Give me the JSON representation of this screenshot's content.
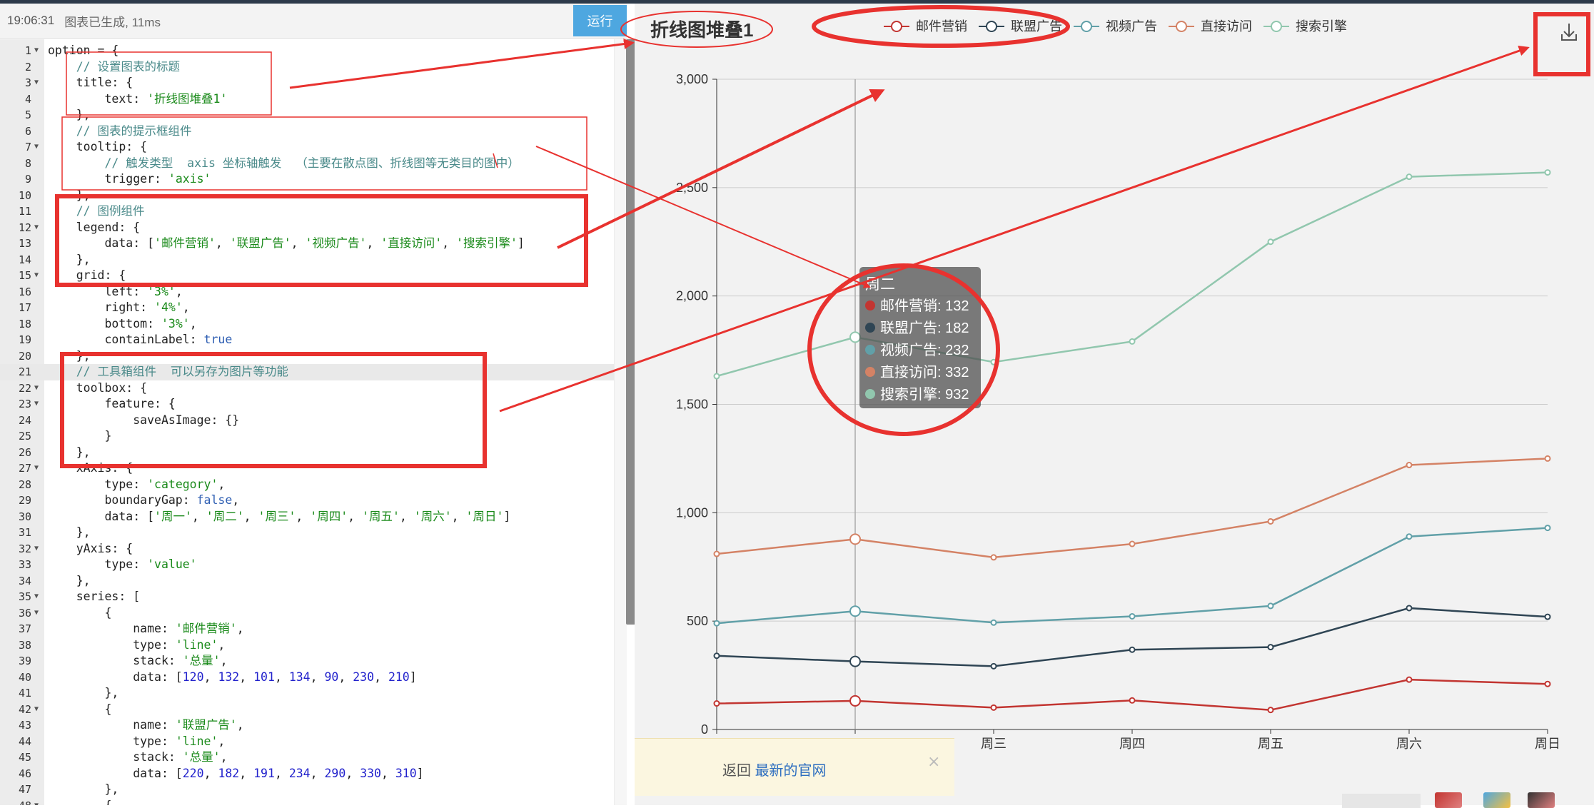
{
  "editor": {
    "status_time": "19:06:31",
    "status_text": "图表已生成, 11ms",
    "run_label": "运行",
    "lines": [
      {
        "n": "1",
        "fold": true,
        "t": [
          [
            "k",
            "option = {"
          ]
        ]
      },
      {
        "n": "2",
        "t": [
          [
            "k",
            "    "
          ],
          [
            "c",
            "// 设置图表的标题"
          ]
        ]
      },
      {
        "n": "3",
        "fold": true,
        "t": [
          [
            "k",
            "    title: {"
          ]
        ]
      },
      {
        "n": "4",
        "t": [
          [
            "k",
            "        text: "
          ],
          [
            "s",
            "'折线图堆叠1'"
          ]
        ]
      },
      {
        "n": "5",
        "t": [
          [
            "k",
            "    },"
          ]
        ]
      },
      {
        "n": "6",
        "t": [
          [
            "k",
            "    "
          ],
          [
            "c",
            "// 图表的提示框组件"
          ]
        ]
      },
      {
        "n": "7",
        "fold": true,
        "t": [
          [
            "k",
            "    tooltip: {"
          ]
        ]
      },
      {
        "n": "8",
        "t": [
          [
            "k",
            "        "
          ],
          [
            "c",
            "// 触发类型  axis 坐标轴触发  （主要在散点图、折线图等无类目的图中）"
          ]
        ]
      },
      {
        "n": "9",
        "t": [
          [
            "k",
            "        trigger: "
          ],
          [
            "s",
            "'axis'"
          ]
        ]
      },
      {
        "n": "10",
        "t": [
          [
            "k",
            "    },"
          ]
        ]
      },
      {
        "n": "11",
        "t": [
          [
            "k",
            "    "
          ],
          [
            "c",
            "// 图例组件"
          ]
        ]
      },
      {
        "n": "12",
        "fold": true,
        "t": [
          [
            "k",
            "    legend: {"
          ]
        ]
      },
      {
        "n": "13",
        "t": [
          [
            "k",
            "        data: ["
          ],
          [
            "s",
            "'邮件营销'"
          ],
          [
            "k",
            ", "
          ],
          [
            "s",
            "'联盟广告'"
          ],
          [
            "k",
            ", "
          ],
          [
            "s",
            "'视频广告'"
          ],
          [
            "k",
            ", "
          ],
          [
            "s",
            "'直接访问'"
          ],
          [
            "k",
            ", "
          ],
          [
            "s",
            "'搜索引擎'"
          ],
          [
            "k",
            "]"
          ]
        ]
      },
      {
        "n": "14",
        "t": [
          [
            "k",
            "    },"
          ]
        ]
      },
      {
        "n": "15",
        "fold": true,
        "t": [
          [
            "k",
            "    grid: {"
          ]
        ]
      },
      {
        "n": "16",
        "t": [
          [
            "k",
            "        left: "
          ],
          [
            "s",
            "'3%'"
          ],
          [
            "k",
            ","
          ]
        ]
      },
      {
        "n": "17",
        "t": [
          [
            "k",
            "        right: "
          ],
          [
            "s",
            "'4%'"
          ],
          [
            "k",
            ","
          ]
        ]
      },
      {
        "n": "18",
        "t": [
          [
            "k",
            "        bottom: "
          ],
          [
            "s",
            "'3%'"
          ],
          [
            "k",
            ","
          ]
        ]
      },
      {
        "n": "19",
        "t": [
          [
            "k",
            "        containLabel: "
          ],
          [
            "b",
            "true"
          ]
        ]
      },
      {
        "n": "20",
        "t": [
          [
            "k",
            "    },"
          ]
        ]
      },
      {
        "n": "21",
        "active": true,
        "t": [
          [
            "k",
            "    "
          ],
          [
            "c",
            "// 工具箱组件  可以另存为图片等功能"
          ]
        ]
      },
      {
        "n": "22",
        "fold": true,
        "t": [
          [
            "k",
            "    toolbox: {"
          ]
        ]
      },
      {
        "n": "23",
        "fold": true,
        "t": [
          [
            "k",
            "        feature: {"
          ]
        ]
      },
      {
        "n": "24",
        "t": [
          [
            "k",
            "            saveAsImage: {}"
          ]
        ]
      },
      {
        "n": "25",
        "t": [
          [
            "k",
            "        }"
          ]
        ]
      },
      {
        "n": "26",
        "t": [
          [
            "k",
            "    },"
          ]
        ]
      },
      {
        "n": "27",
        "fold": true,
        "t": [
          [
            "k",
            "    xAxis: {"
          ]
        ]
      },
      {
        "n": "28",
        "t": [
          [
            "k",
            "        type: "
          ],
          [
            "s",
            "'category'"
          ],
          [
            "k",
            ","
          ]
        ]
      },
      {
        "n": "29",
        "t": [
          [
            "k",
            "        boundaryGap: "
          ],
          [
            "b",
            "false"
          ],
          [
            "k",
            ","
          ]
        ]
      },
      {
        "n": "30",
        "t": [
          [
            "k",
            "        data: ["
          ],
          [
            "s",
            "'周一'"
          ],
          [
            "k",
            ", "
          ],
          [
            "s",
            "'周二'"
          ],
          [
            "k",
            ", "
          ],
          [
            "s",
            "'周三'"
          ],
          [
            "k",
            ", "
          ],
          [
            "s",
            "'周四'"
          ],
          [
            "k",
            ", "
          ],
          [
            "s",
            "'周五'"
          ],
          [
            "k",
            ", "
          ],
          [
            "s",
            "'周六'"
          ],
          [
            "k",
            ", "
          ],
          [
            "s",
            "'周日'"
          ],
          [
            "k",
            "]"
          ]
        ]
      },
      {
        "n": "31",
        "t": [
          [
            "k",
            "    },"
          ]
        ]
      },
      {
        "n": "32",
        "fold": true,
        "t": [
          [
            "k",
            "    yAxis: {"
          ]
        ]
      },
      {
        "n": "33",
        "t": [
          [
            "k",
            "        type: "
          ],
          [
            "s",
            "'value'"
          ]
        ]
      },
      {
        "n": "34",
        "t": [
          [
            "k",
            "    },"
          ]
        ]
      },
      {
        "n": "35",
        "fold": true,
        "t": [
          [
            "k",
            "    series: ["
          ]
        ]
      },
      {
        "n": "36",
        "fold": true,
        "t": [
          [
            "k",
            "        {"
          ]
        ]
      },
      {
        "n": "37",
        "t": [
          [
            "k",
            "            name: "
          ],
          [
            "s",
            "'邮件营销'"
          ],
          [
            "k",
            ","
          ]
        ]
      },
      {
        "n": "38",
        "t": [
          [
            "k",
            "            type: "
          ],
          [
            "s",
            "'line'"
          ],
          [
            "k",
            ","
          ]
        ]
      },
      {
        "n": "39",
        "t": [
          [
            "k",
            "            stack: "
          ],
          [
            "s",
            "'总量'"
          ],
          [
            "k",
            ","
          ]
        ]
      },
      {
        "n": "40",
        "t": [
          [
            "k",
            "            data: ["
          ],
          [
            "n",
            "120"
          ],
          [
            "k",
            ", "
          ],
          [
            "n",
            "132"
          ],
          [
            "k",
            ", "
          ],
          [
            "n",
            "101"
          ],
          [
            "k",
            ", "
          ],
          [
            "n",
            "134"
          ],
          [
            "k",
            ", "
          ],
          [
            "n",
            "90"
          ],
          [
            "k",
            ", "
          ],
          [
            "n",
            "230"
          ],
          [
            "k",
            ", "
          ],
          [
            "n",
            "210"
          ],
          [
            "k",
            "]"
          ]
        ]
      },
      {
        "n": "41",
        "t": [
          [
            "k",
            "        },"
          ]
        ]
      },
      {
        "n": "42",
        "fold": true,
        "t": [
          [
            "k",
            "        {"
          ]
        ]
      },
      {
        "n": "43",
        "t": [
          [
            "k",
            "            name: "
          ],
          [
            "s",
            "'联盟广告'"
          ],
          [
            "k",
            ","
          ]
        ]
      },
      {
        "n": "44",
        "t": [
          [
            "k",
            "            type: "
          ],
          [
            "s",
            "'line'"
          ],
          [
            "k",
            ","
          ]
        ]
      },
      {
        "n": "45",
        "t": [
          [
            "k",
            "            stack: "
          ],
          [
            "s",
            "'总量'"
          ],
          [
            "k",
            ","
          ]
        ]
      },
      {
        "n": "46",
        "t": [
          [
            "k",
            "            data: ["
          ],
          [
            "n",
            "220"
          ],
          [
            "k",
            ", "
          ],
          [
            "n",
            "182"
          ],
          [
            "k",
            ", "
          ],
          [
            "n",
            "191"
          ],
          [
            "k",
            ", "
          ],
          [
            "n",
            "234"
          ],
          [
            "k",
            ", "
          ],
          [
            "n",
            "290"
          ],
          [
            "k",
            ", "
          ],
          [
            "n",
            "330"
          ],
          [
            "k",
            ", "
          ],
          [
            "n",
            "310"
          ],
          [
            "k",
            "]"
          ]
        ]
      },
      {
        "n": "47",
        "t": [
          [
            "k",
            "        },"
          ]
        ]
      },
      {
        "n": "48",
        "fold": true,
        "t": [
          [
            "k",
            "        {"
          ]
        ]
      }
    ]
  },
  "notice": {
    "prefix": "返回 ",
    "link": "最新的官网",
    "close": "×"
  },
  "chart_data": {
    "type": "line",
    "title": "折线图堆叠1",
    "stacked": true,
    "categories": [
      "周一",
      "周二",
      "周三",
      "周四",
      "周五",
      "周六",
      "周日"
    ],
    "visible_x_ticks": [
      "周三",
      "周四",
      "周五",
      "周六",
      "周日"
    ],
    "ylim": [
      0,
      3000
    ],
    "y_ticks": [
      "0",
      "500",
      "1,000",
      "1,500",
      "2,000",
      "2,500",
      "3,000"
    ],
    "grid": true,
    "legend_position": "top",
    "series": [
      {
        "name": "邮件营销",
        "color": "#c23531",
        "values": [
          120,
          132,
          101,
          134,
          90,
          230,
          210
        ]
      },
      {
        "name": "联盟广告",
        "color": "#2f4554",
        "values": [
          220,
          182,
          191,
          234,
          290,
          330,
          310
        ]
      },
      {
        "name": "视频广告",
        "color": "#61a0a8",
        "values": [
          150,
          232,
          201,
          154,
          190,
          330,
          410
        ]
      },
      {
        "name": "直接访问",
        "color": "#d48265",
        "values": [
          320,
          332,
          301,
          334,
          390,
          330,
          320
        ]
      },
      {
        "name": "搜索引擎",
        "color": "#91c7ae",
        "values": [
          820,
          932,
          901,
          934,
          1290,
          1330,
          1320
        ]
      }
    ],
    "tooltip": {
      "title": "周二",
      "rows": [
        {
          "label": "邮件营销: 132",
          "color": "#c23531"
        },
        {
          "label": "联盟广告: 182",
          "color": "#2f4554"
        },
        {
          "label": "视频广告: 232",
          "color": "#61a0a8"
        },
        {
          "label": "直接访问: 332",
          "color": "#d48265"
        },
        {
          "label": "搜索引擎: 932",
          "color": "#91c7ae"
        }
      ]
    },
    "highlight_index": 1,
    "toolbox": "download-icon"
  }
}
